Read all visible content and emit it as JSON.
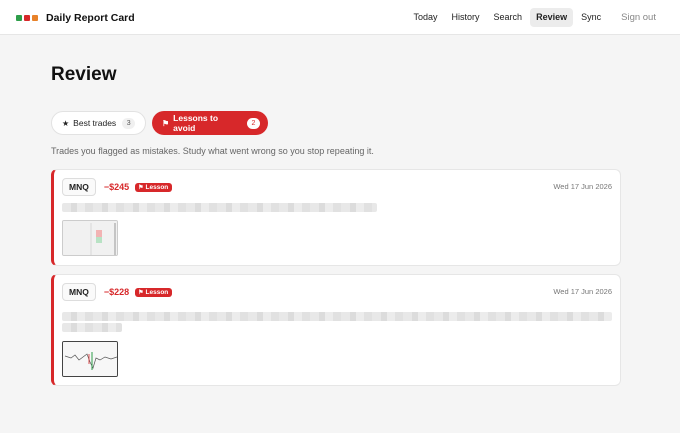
{
  "header": {
    "brand_colors": [
      "#2e9e4a",
      "#d7282a",
      "#e8822a"
    ],
    "title": "Daily Report Card",
    "nav": [
      {
        "label": "Today"
      },
      {
        "label": "History"
      },
      {
        "label": "Search"
      },
      {
        "label": "Review",
        "active": true
      },
      {
        "label": "Sync"
      }
    ],
    "sign_out": "Sign out"
  },
  "page": {
    "title": "Review",
    "tabs": [
      {
        "icon": "star-icon",
        "label": "Best trades",
        "count": "3"
      },
      {
        "icon": "flag-icon",
        "label": "Lessons to avoid",
        "count": "2",
        "active": true
      }
    ],
    "subtitle": "Trades you flagged as mistakes. Study what went wrong so you stop repeating it."
  },
  "cards": [
    {
      "symbol": "MNQ",
      "pnl": "−$245",
      "badge": "Lesson",
      "date": "Wed 17 Jun 2026"
    },
    {
      "symbol": "MNQ",
      "pnl": "−$228",
      "badge": "Lesson",
      "date": "Wed 17 Jun 2026"
    }
  ],
  "colors": {
    "accent": "#d7282a",
    "background": "#f5f5f5"
  }
}
